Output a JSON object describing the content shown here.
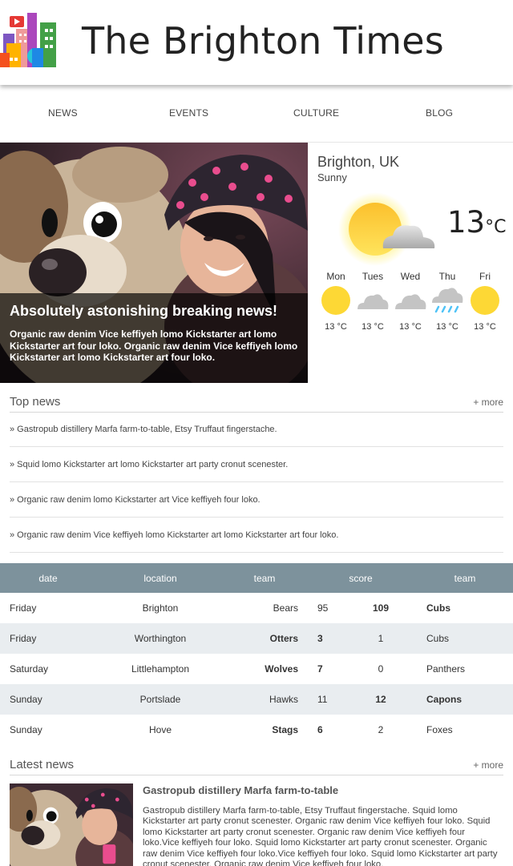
{
  "header": {
    "title": "The Brighton Times",
    "logo_icon": "city-buildings-logo"
  },
  "nav": {
    "items": [
      "NEWS",
      "EVENTS",
      "CULTURE",
      "BLOG"
    ]
  },
  "hero": {
    "headline": "Absolutely astonishing breaking news!",
    "text": "Organic raw denim Vice keffiyeh lomo Kickstarter art lomo Kickstarter art four loko. Organic raw denim Vice keffiyeh lomo Kickstarter art lomo Kickstarter art four loko."
  },
  "weather": {
    "location": "Brighton, UK",
    "condition": "Sunny",
    "temp": "13",
    "unit": "°C",
    "icon": "sun-behind-cloud-icon",
    "forecast": [
      {
        "day": "Mon",
        "temp": "13 °C",
        "icon": "sun-icon"
      },
      {
        "day": "Tues",
        "temp": "13 °C",
        "icon": "cloud-icon"
      },
      {
        "day": "Wed",
        "temp": "13 °C",
        "icon": "cloud-icon"
      },
      {
        "day": "Thu",
        "temp": "13 °C",
        "icon": "rain-cloud-icon"
      },
      {
        "day": "Fri",
        "temp": "13 °C",
        "icon": "sun-icon"
      }
    ]
  },
  "top_news": {
    "title": "Top news",
    "more": "+ more",
    "items": [
      "» Gastropub distillery Marfa farm-to-table, Etsy Truffaut fingerstache.",
      "» Squid lomo Kickstarter art lomo Kickstarter art party cronut scenester.",
      "» Organic raw denim lomo Kickstarter art Vice keffiyeh four loko.",
      "» Organic raw denim Vice keffiyeh lomo Kickstarter art lomo Kickstarter art four loko."
    ]
  },
  "scores": {
    "headers": [
      "date",
      "location",
      "team",
      "score",
      "team"
    ],
    "rows": [
      {
        "date": "Friday",
        "location": "Brighton",
        "team1": "Bears",
        "score1": "95",
        "score2": "109",
        "team2": "Cubs",
        "winner": 2
      },
      {
        "date": "Friday",
        "location": "Worthington",
        "team1": "Otters",
        "score1": "3",
        "score2": "1",
        "team2": "Cubs",
        "winner": 1
      },
      {
        "date": "Saturday",
        "location": "Littlehampton",
        "team1": "Wolves",
        "score1": "7",
        "score2": "0",
        "team2": "Panthers",
        "winner": 1
      },
      {
        "date": "Sunday",
        "location": "Portslade",
        "team1": "Hawks",
        "score1": "11",
        "score2": "12",
        "team2": "Capons",
        "winner": 2
      },
      {
        "date": "Sunday",
        "location": "Hove",
        "team1": "Stags",
        "score1": "6",
        "score2": "2",
        "team2": "Foxes",
        "winner": 1
      }
    ]
  },
  "latest_news": {
    "title": "Latest news",
    "more": "+ more",
    "article_title": "Gastropub distillery Marfa farm-to-table",
    "article_text": "Gastropub distillery Marfa farm-to-table, Etsy Truffaut fingerstache. Squid lomo Kickstarter art party cronut scenester. Organic raw denim Vice keffiyeh four loko. Squid lomo Kickstarter art party cronut scenester. Organic raw denim Vice keffiyeh four loko.Vice keffiyeh four loko. Squid lomo Kickstarter art party cronut scenester. Organic raw denim Vice keffiyeh four loko.Vice keffiyeh four loko. Squid lomo Kickstarter art party cronut scenester. Organic raw denim Vice keffiyeh four loko."
  },
  "colors": {
    "table_header": "#7d929c",
    "table_alt_row": "#e9edf0",
    "sun": "#fdd835"
  }
}
